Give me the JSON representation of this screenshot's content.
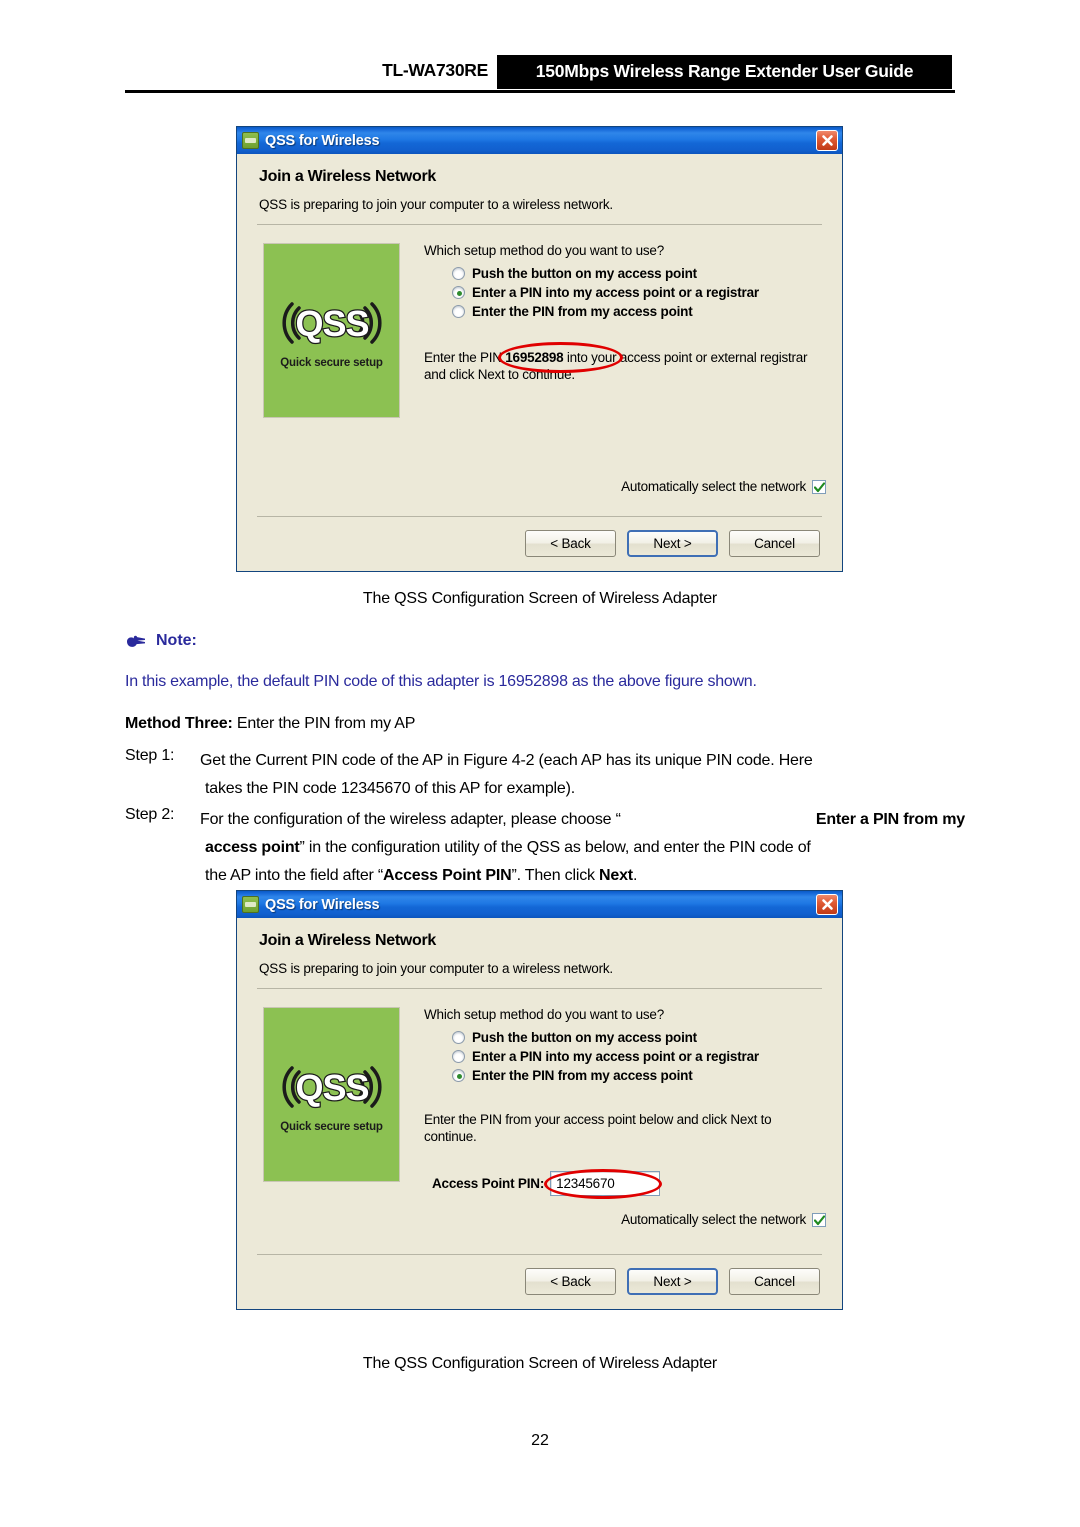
{
  "header": {
    "model": "TL-WA730RE",
    "title": "150Mbps Wireless Range Extender User Guide"
  },
  "dialog_top": {
    "titlebar": "QSS for Wireless",
    "heading": "Join a Wireless Network",
    "subtitle": "QSS is preparing to join your computer to a wireless network.",
    "graphic": {
      "logo_text": "QSS",
      "tagline": "Quick secure setup",
      "background_color": "#8cc152"
    },
    "prompt": "Which setup method do you want to use?",
    "options": [
      {
        "label": "Push the button on my access point",
        "selected": false
      },
      {
        "label": "Enter a PIN into my access point or a registrar",
        "selected": true
      },
      {
        "label": "Enter the PIN from my access point",
        "selected": false
      }
    ],
    "pin_note_before": "Enter the PIN ",
    "pin_value": "16952898",
    "pin_note_after": " into your access point or external registrar",
    "pin_note_line2": "and click Next to continue.",
    "auto_select_label": "Automatically select the network",
    "auto_select_checked": true,
    "buttons": [
      {
        "label": "< Back",
        "default": false
      },
      {
        "label": "Next >",
        "default": true
      },
      {
        "label": "Cancel",
        "default": false
      }
    ],
    "annotation_color": "#e00000"
  },
  "caption_top": "The QSS Configuration Screen of Wireless Adapter",
  "note": {
    "icon": "pointing-hand-icon",
    "label": "Note:",
    "text": "In this example, the default PIN code of this adapter is 16952898 as the above figure shown.",
    "color": "#2a2a9c"
  },
  "method": {
    "bold_prefix": "Method Three:",
    "rest": " Enter the PIN from my AP"
  },
  "steps": [
    {
      "label": "Step 1:",
      "lines": [
        "Get the Current PIN code of the AP in Figure 4-2 (each AP has its unique PIN code. Here",
        "takes the PIN code 12345670 of this AP for example)."
      ]
    },
    {
      "label": "Step 2:",
      "line1_a": "For the configuration of the wireless adapter, please choose “",
      "line1_b": "Enter a PIN from my",
      "line2_a": "access point",
      "line2_b": "” in the configuration utility of the QSS as below, and enter the PIN code of",
      "line3_a": "the AP into the field after “",
      "line3_b": "Access Point PIN",
      "line3_c": "”. Then click ",
      "line3_d": "Next",
      "line3_e": "."
    }
  ],
  "dialog_bottom": {
    "titlebar": "QSS for Wireless",
    "heading": "Join a Wireless Network",
    "subtitle": "QSS is preparing to join your computer to a wireless network.",
    "graphic": {
      "logo_text": "QSS",
      "tagline": "Quick secure setup",
      "background_color": "#8cc152"
    },
    "prompt": "Which setup method do you want to use?",
    "options": [
      {
        "label": "Push the button on my access point",
        "selected": false
      },
      {
        "label": "Enter a PIN into my access point or a registrar",
        "selected": false
      },
      {
        "label": "Enter the PIN from my access point",
        "selected": true
      }
    ],
    "instruction": "Enter the PIN from your access point below and click Next to continue.",
    "ap_pin_label": "Access Point PIN:",
    "ap_pin_value": "12345670",
    "auto_select_label": "Automatically select the network",
    "auto_select_checked": true,
    "buttons": [
      {
        "label": "< Back",
        "default": false
      },
      {
        "label": "Next >",
        "default": true
      },
      {
        "label": "Cancel",
        "default": false
      }
    ],
    "annotation_color": "#e00000"
  },
  "caption_bottom": "The QSS Configuration Screen of Wireless Adapter",
  "page_number": "22"
}
